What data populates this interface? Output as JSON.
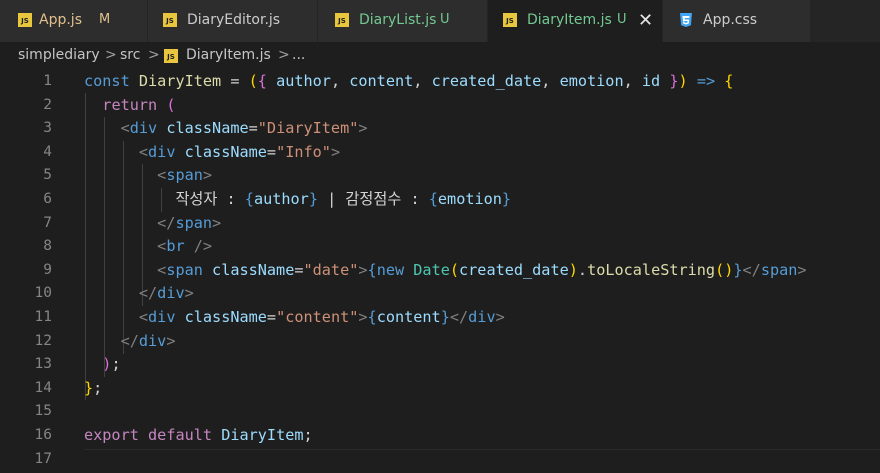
{
  "tabs": [
    {
      "label": "App.js",
      "status": "M",
      "icon": "js-icon",
      "label_color": "#e2c08d",
      "status_color": "#e2c08d"
    },
    {
      "label": "DiaryEditor.js",
      "status": "",
      "icon": "js-icon",
      "label_color": "#cccccc",
      "status_color": ""
    },
    {
      "label": "DiaryList.js",
      "status": "U",
      "icon": "js-icon",
      "label_color": "#73c991",
      "status_color": "#73c991"
    },
    {
      "label": "DiaryItem.js",
      "status": "U",
      "icon": "js-icon",
      "label_color": "#73c991",
      "status_color": "#73c991",
      "active": true
    },
    {
      "label": "App.css",
      "status": "",
      "icon": "css-icon",
      "label_color": "#cccccc",
      "status_color": ""
    }
  ],
  "breadcrumb": {
    "parts": [
      "simplediary",
      "src",
      "DiaryItem.js",
      "..."
    ],
    "separator": ">"
  },
  "line_numbers": [
    "1",
    "2",
    "3",
    "4",
    "5",
    "6",
    "7",
    "8",
    "9",
    "10",
    "11",
    "12",
    "13",
    "14",
    "15",
    "16",
    "17"
  ],
  "code": {
    "l1": {
      "const": "const",
      "name": "DiaryItem",
      "eq": " = ",
      "open": "(",
      "brace": "{",
      "p1": "author",
      "p2": "content",
      "p3": "created_date",
      "p4": "emotion",
      "p5": "id",
      "close_brace": "}",
      "close": ")",
      "arrow": "=>",
      "body_open": "{"
    },
    "l2": {
      "ret": "return",
      "paren": "("
    },
    "l3": {
      "tag": "div",
      "attr": "className",
      "val": "\"DiaryItem\""
    },
    "l4": {
      "tag": "div",
      "attr": "className",
      "val": "\"Info\""
    },
    "l5": {
      "tag": "span"
    },
    "l6": {
      "t1": "작성자 : ",
      "e1o": "{",
      "e1": "author",
      "e1c": "}",
      "t2": " | 감정점수 : ",
      "e2o": "{",
      "e2": "emotion",
      "e2c": "}"
    },
    "l7": {
      "tag": "span"
    },
    "l8": {
      "tag": "br"
    },
    "l9": {
      "tag": "span",
      "attr": "className",
      "val": "\"date\"",
      "eo": "{",
      "new": "new",
      "cls": "Date",
      "po": "(",
      "arg": "created_date",
      "pc": ")",
      "dot": ".",
      "fn": "toLocaleString",
      "call": "()",
      "ec": "}",
      "ctag": "span"
    },
    "l10": {
      "tag": "div"
    },
    "l11": {
      "tag": "div",
      "attr": "className",
      "val": "\"content\"",
      "eo": "{",
      "expr": "content",
      "ec": "}",
      "ctag": "div"
    },
    "l12": {
      "tag": "div"
    },
    "l13": {
      "paren": ")",
      "semi": ";"
    },
    "l14": {
      "brace": "}",
      "semi": ";"
    },
    "l16": {
      "export": "export",
      "default": "default",
      "name": "DiaryItem",
      "semi": ";"
    }
  }
}
